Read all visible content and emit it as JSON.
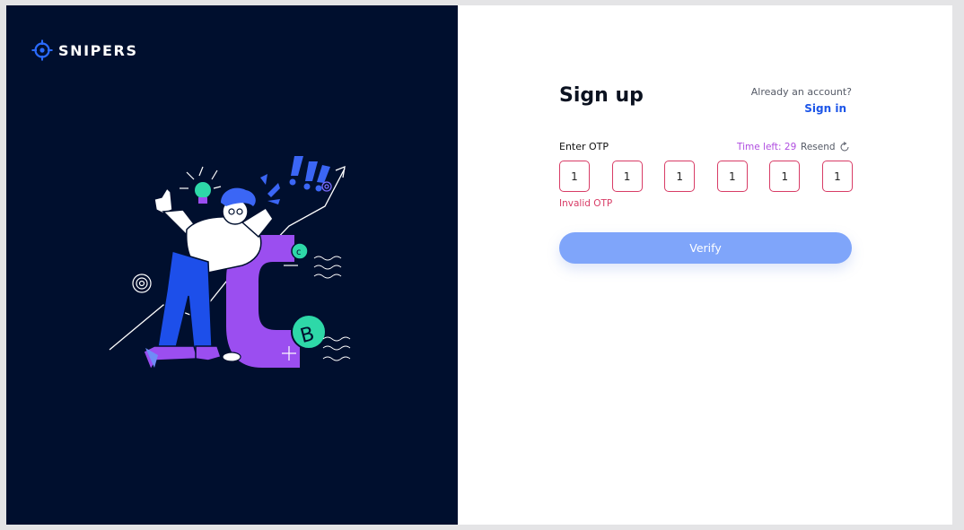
{
  "brand": {
    "name": "SNIPERS"
  },
  "signup": {
    "title": "Sign up",
    "already_text": "Already an account?",
    "signin_link": "Sign in"
  },
  "otp": {
    "label": "Enter OTP",
    "time_left": "Time left: 29",
    "resend": "Resend",
    "digits": [
      "1",
      "1",
      "1",
      "1",
      "1",
      "1"
    ],
    "error": "Invalid OTP"
  },
  "verify_button": "Verify",
  "colors": {
    "panel_bg": "#000f2e",
    "accent_blue": "#1c55e8",
    "error_red": "#d83c66",
    "timer_purple": "#b04ee0",
    "button_disabled": "#7fa5fa"
  },
  "icons": {
    "logo": "crosshair-icon",
    "resend": "refresh-icon"
  }
}
